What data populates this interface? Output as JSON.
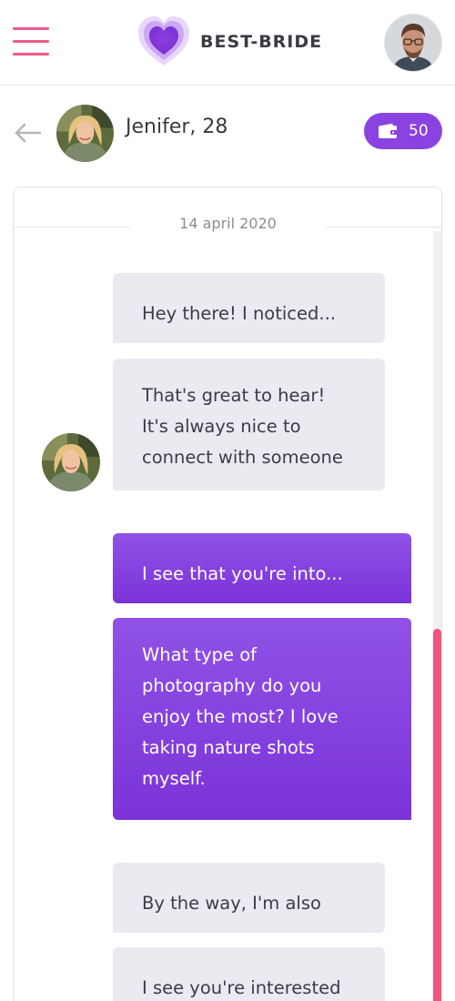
{
  "app": {
    "brand": "BEST-BRIDE",
    "accent_color": "#8a43e0",
    "menu_color": "#ef5b86"
  },
  "header": {
    "menu_icon": "hamburger-menu-icon",
    "logo_icon": "heart-icon",
    "user_avatar": "user-avatar-photo"
  },
  "chat_header": {
    "back_icon": "arrow-left-icon",
    "contact_name": "Jenifer, 28",
    "credits": {
      "icon": "wallet-icon",
      "count": "50"
    }
  },
  "chat": {
    "date": "14 april 2020",
    "messages": [
      {
        "direction": "incoming",
        "text": "Hey there! I noticed..."
      },
      {
        "direction": "incoming",
        "text": "That's great to hear!\nIt's always nice to\nconnect with someone"
      },
      {
        "direction": "outgoing",
        "text": "I see that you're into..."
      },
      {
        "direction": "outgoing",
        "text": "What type of\nphotography do you\nenjoy the most? I love\ntaking nature shots\nmyself."
      },
      {
        "direction": "incoming",
        "text": "By the way, I'm also"
      },
      {
        "direction": "incoming",
        "text": "I see you're interested"
      }
    ],
    "scrollbar_color": "#f3537e"
  }
}
